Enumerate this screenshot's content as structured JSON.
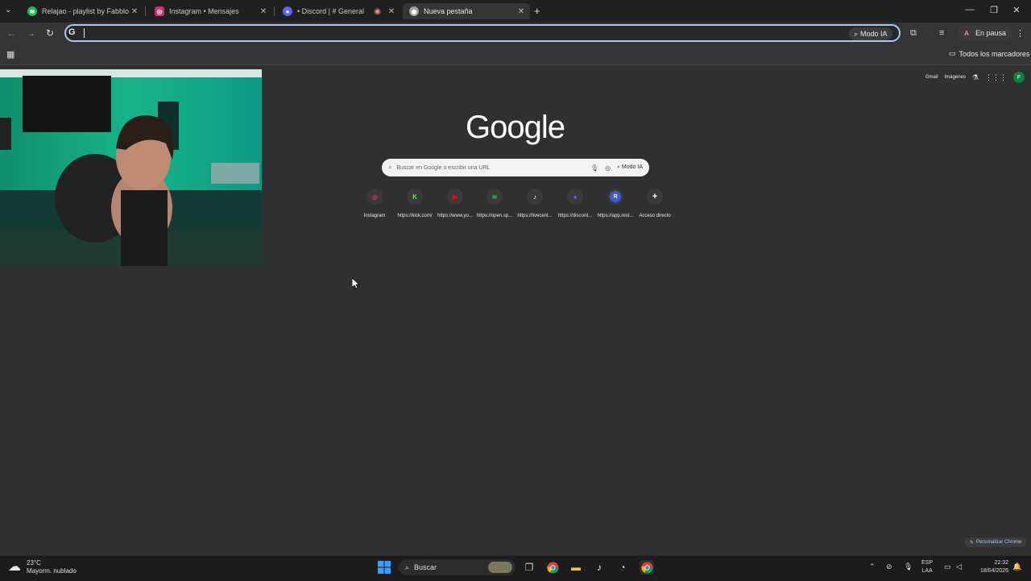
{
  "tabs": [
    {
      "title": "Relajao - playlist by Fabblock Ji",
      "icon": "spotify-icon",
      "color": "#1db954"
    },
    {
      "title": "Instagram • Mensajes",
      "icon": "instagram-icon",
      "color": "#d62976"
    },
    {
      "title": "• Discord | # General",
      "icon": "discord-icon",
      "color": "#5865f2"
    },
    {
      "title": "Nueva pestaña",
      "icon": "chrome-icon",
      "color": "#9aa0a6"
    }
  ],
  "toolbar": {
    "omnibox_value": "",
    "modo_ia": "Modo IA",
    "profile_status": "En pausa",
    "profile_initial": "A"
  },
  "bookmarks": {
    "all_label": "Todos los marcadores"
  },
  "google": {
    "logo": "Google",
    "links": [
      "Gmail",
      "Imágenes"
    ],
    "account_initial": "F",
    "search_placeholder": "Buscar en Google o escribir una URL",
    "modo_ia": "Modo IA",
    "customize": "Personalizar Chrome",
    "shortcuts": [
      {
        "label": "Instagram",
        "icon": "instagram-icon",
        "color": "#d62976",
        "glyph": "◎"
      },
      {
        "label": "https://kick.com/",
        "icon": "kick-icon",
        "color": "#53fc18",
        "glyph": "K"
      },
      {
        "label": "https://www.yo...",
        "icon": "youtube-icon",
        "color": "#ff0000",
        "glyph": "▶"
      },
      {
        "label": "https://open.sp...",
        "icon": "spotify-icon",
        "color": "#1db954",
        "glyph": "≋"
      },
      {
        "label": "https://livecent...",
        "icon": "tiktok-icon",
        "color": "#ffffff",
        "glyph": "♪"
      },
      {
        "label": "https://discord...",
        "icon": "discord-icon",
        "color": "#5865f2",
        "glyph": "●"
      },
      {
        "label": "https://app.rest...",
        "icon": "restream-icon",
        "color": "#3b5bdb",
        "glyph": "R"
      },
      {
        "label": "Acceso directo",
        "icon": "add-icon",
        "color": "#e8eaed",
        "glyph": "+"
      }
    ]
  },
  "taskbar": {
    "weather_temp": "23°C",
    "weather_desc": "Mayorm. nublado",
    "search_label": "Buscar",
    "lang": "ESP",
    "lang_sub": "LAA",
    "time": "22:32",
    "date": "18/04/2026"
  }
}
